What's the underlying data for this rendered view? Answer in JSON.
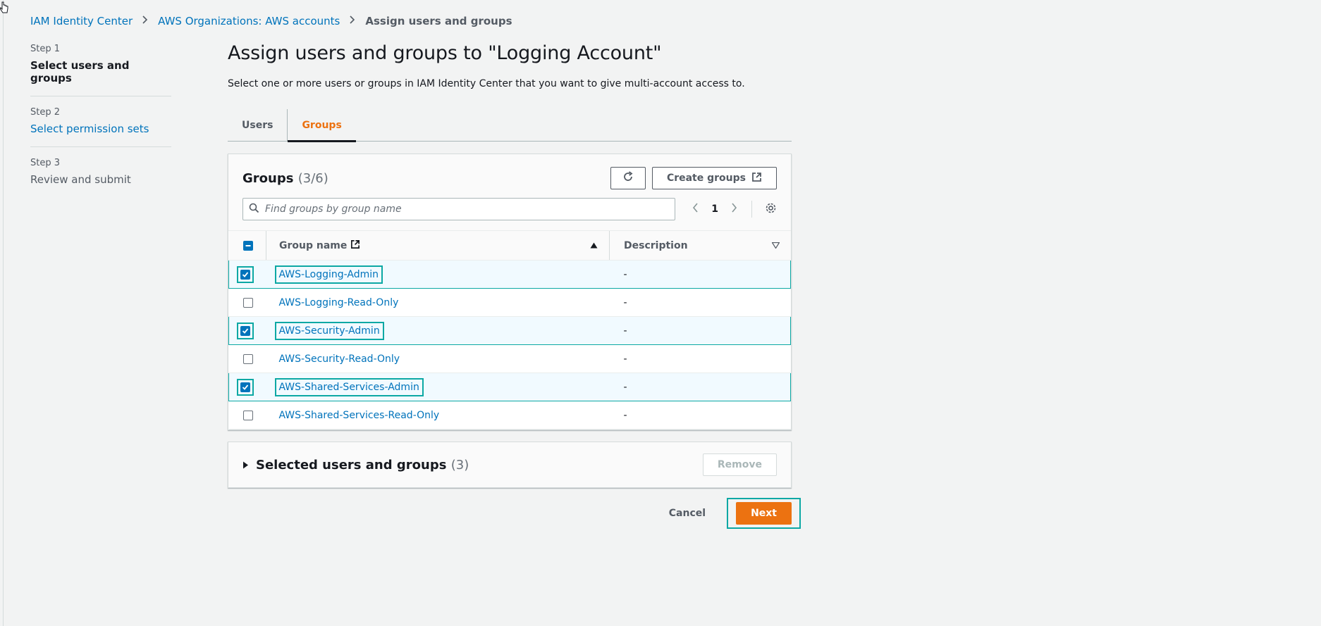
{
  "breadcrumb": {
    "items": [
      "IAM Identity Center",
      "AWS Organizations: AWS accounts"
    ],
    "current": "Assign users and groups"
  },
  "steps": [
    {
      "label": "Step 1",
      "title": "Select users and groups",
      "state": "current"
    },
    {
      "label": "Step 2",
      "title": "Select permission sets",
      "state": "link"
    },
    {
      "label": "Step 3",
      "title": "Review and submit",
      "state": "disabled"
    }
  ],
  "page": {
    "title": "Assign users and groups to \"Logging Account\"",
    "description": "Select one or more users or groups in IAM Identity Center that you want to give multi-account access to."
  },
  "tabs": [
    {
      "label": "Users",
      "active": false
    },
    {
      "label": "Groups",
      "active": true
    }
  ],
  "groups_table": {
    "title": "Groups",
    "count": "(3/6)",
    "create_button": "Create groups",
    "search_placeholder": "Find groups by group name",
    "page": "1",
    "columns": {
      "name": "Group name",
      "description": "Description"
    },
    "rows": [
      {
        "name": "AWS-Logging-Admin",
        "description": "-",
        "selected": true
      },
      {
        "name": "AWS-Logging-Read-Only",
        "description": "-",
        "selected": false
      },
      {
        "name": "AWS-Security-Admin",
        "description": "-",
        "selected": true
      },
      {
        "name": "AWS-Security-Read-Only",
        "description": "-",
        "selected": false
      },
      {
        "name": "AWS-Shared-Services-Admin",
        "description": "-",
        "selected": true
      },
      {
        "name": "AWS-Shared-Services-Read-Only",
        "description": "-",
        "selected": false
      }
    ]
  },
  "selected_section": {
    "title": "Selected users and groups",
    "count": "(3)",
    "remove_button": "Remove"
  },
  "footer": {
    "cancel": "Cancel",
    "next": "Next"
  },
  "colors": {
    "accent": "#ec7211",
    "link": "#0073bb",
    "highlight": "#0ca8a4"
  }
}
